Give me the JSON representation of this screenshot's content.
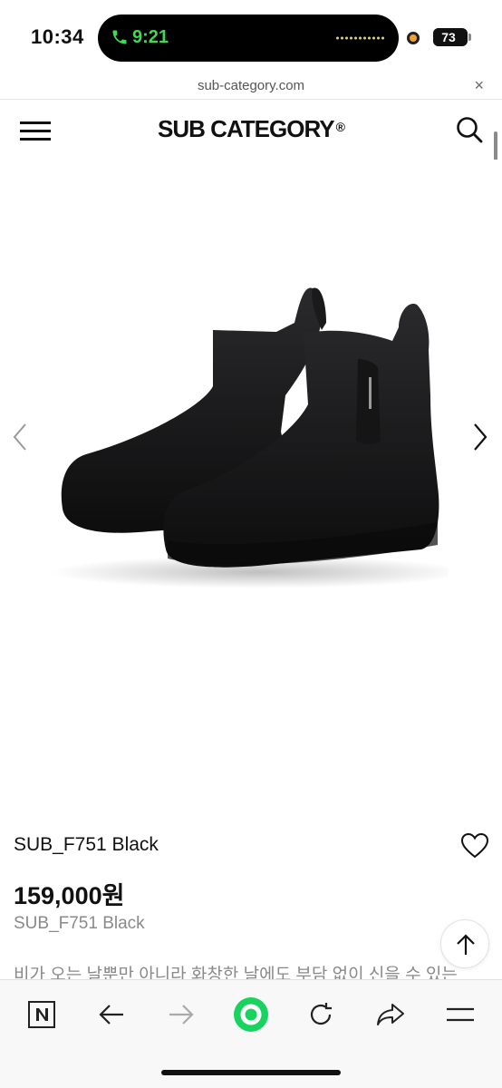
{
  "status_bar": {
    "time": "10:34",
    "call_time": "9:21",
    "battery_percent": "73",
    "battery_level": 0.73,
    "call_color": "#3ddc4f"
  },
  "browser": {
    "url": "sub-category.com",
    "close_glyph": "×"
  },
  "site": {
    "brand": "SUB CATEGORY",
    "brand_mark": "®",
    "menu_icon": "hamburger-icon",
    "search_icon": "search-icon"
  },
  "gallery": {
    "prev_icon": "chevron-left-icon",
    "next_icon": "chevron-right-icon",
    "image": "black-chelsea-rain-boots"
  },
  "product": {
    "name": "SUB_F751 Black",
    "price": "159,000원",
    "sku": "SUB_F751 Black",
    "description": "비가 오는 날뿐만 아니라 화창한 날에도 부담 없이 신을 수 있는"
  },
  "toolbar": {
    "items": [
      "naver-icon",
      "back-icon",
      "forward-icon",
      "green-ring-icon",
      "reload-icon",
      "share-icon",
      "menu-icon"
    ],
    "accent": "#19d35f"
  }
}
